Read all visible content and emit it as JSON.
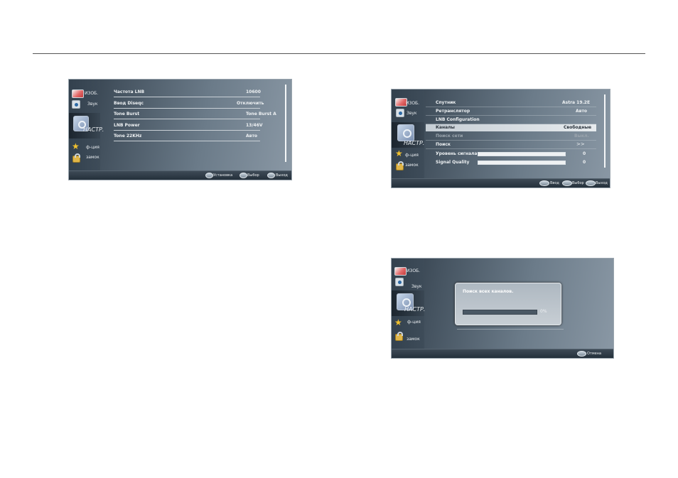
{
  "sidebar": {
    "picture": "ИЗОБ.",
    "sound": "Звук",
    "setup": "НАСТР.",
    "function": "ф-ция",
    "lock": "замок"
  },
  "screen1": {
    "rows": [
      {
        "label": "Частота LNB",
        "value": "10600"
      },
      {
        "label": "Ввод Diseqc",
        "value": "Отключить"
      },
      {
        "label": "Tone Burst",
        "value": "Tone Burst A"
      },
      {
        "label": "LNB Power",
        "value": "13/46V"
      },
      {
        "label": "Tone 22KHz",
        "value": "Авто"
      }
    ],
    "footer": {
      "install": "Установка",
      "select": "Выбор",
      "exit": "Выход"
    }
  },
  "screen2": {
    "rows": [
      {
        "label": "Спутник",
        "value": "Astra 19.2E"
      },
      {
        "label": "Ретранслятор",
        "value": "Авто"
      },
      {
        "label": "LNB Configuration",
        "value": ""
      },
      {
        "label": "Каналы",
        "value": "Свободные"
      },
      {
        "label": "Поиск сети",
        "value": "Выкл."
      },
      {
        "label": "Поиск",
        "value": ">>"
      }
    ],
    "signal_level": {
      "label": "Уровень сигнала",
      "value": "0",
      "fraction": 1.0
    },
    "signal_quality": {
      "label": "Signal Quality",
      "value": "0",
      "fraction": 1.0
    },
    "footer": {
      "enter": "Ввод",
      "select": "Выбор",
      "exit": "Выход"
    }
  },
  "screen3": {
    "dialog_title": "Поиск всех каналов.",
    "progress_text": "0%",
    "progress_fraction": 1.0,
    "footer": {
      "cancel": "Отмена"
    }
  },
  "colors": {
    "panel": "#4b5966",
    "sidebar": "#33414e",
    "selected_row": "#e7ebee",
    "accent_star": "#f2c22e"
  }
}
